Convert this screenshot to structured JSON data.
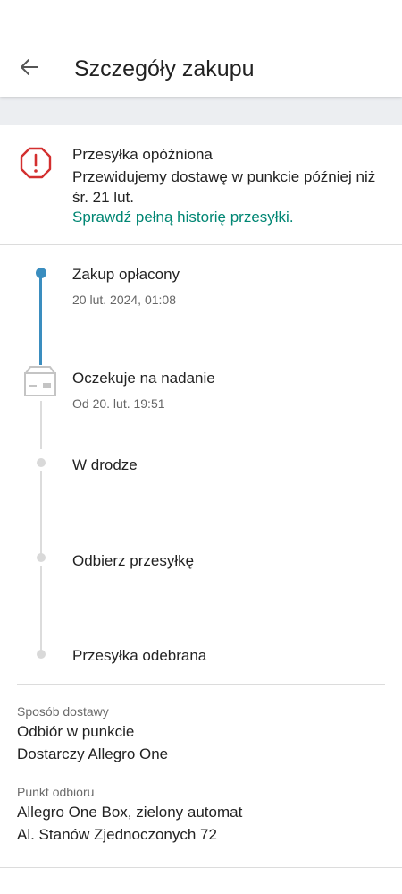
{
  "header": {
    "title": "Szczegóły zakupu",
    "back_icon": "arrow-left-icon"
  },
  "alert": {
    "icon": "warning-octagon-icon",
    "icon_color": "#d32f2f",
    "title": "Przesyłka opóźniona",
    "text": "Przewidujemy dostawę w punkcie później niż śr. 21 lut.",
    "link": "Sprawdź pełną historię przesyłki.",
    "link_color": "#008673"
  },
  "timeline": {
    "active_color": "#3a8dbf",
    "steps": [
      {
        "title": "Zakup opłacony",
        "subtitle": "20 lut. 2024, 01:08"
      },
      {
        "title": "Oczekuje na nadanie",
        "subtitle": "Od 20. lut. 19:51",
        "icon": "package-box-icon"
      },
      {
        "title": "W drodze"
      },
      {
        "title": "Odbierz przesyłkę"
      },
      {
        "title": "Przesyłka odebrana"
      }
    ]
  },
  "delivery": {
    "method_label": "Sposób dostawy",
    "method_line1": "Odbiór w punkcie",
    "method_line2": "Dostarczy Allegro One",
    "point_label": "Punkt odbioru",
    "point_line1": "Allegro One Box, zielony automat",
    "point_line2": "Al. Stanów Zjednoczonych 72"
  }
}
